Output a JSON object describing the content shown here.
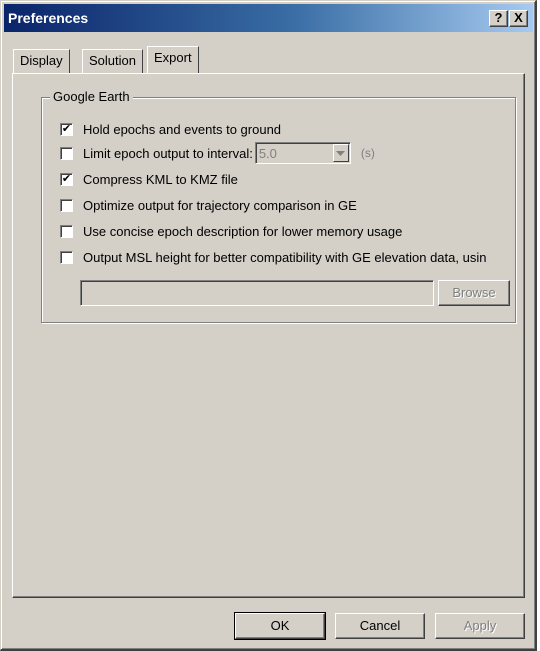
{
  "window": {
    "title": "Preferences"
  },
  "title_buttons": {
    "help": "?",
    "close": "X"
  },
  "tabs": [
    {
      "label": "Display",
      "active": false
    },
    {
      "label": "Solution",
      "active": false
    },
    {
      "label": "Export",
      "active": true
    }
  ],
  "export": {
    "group_title": "Google Earth",
    "options": [
      {
        "label": "Hold epochs and events to ground",
        "checked": true,
        "mark": "✔"
      },
      {
        "label": "Limit epoch output to interval:",
        "checked": false,
        "mark": ""
      },
      {
        "label": "Compress KML to KMZ file",
        "checked": true,
        "mark": "✔"
      },
      {
        "label": "Optimize output for trajectory comparison in GE",
        "checked": false,
        "mark": ""
      },
      {
        "label": "Use concise epoch description for lower memory usage",
        "checked": false,
        "mark": ""
      },
      {
        "label": "Output MSL height for better compatibility with GE elevation data, usin",
        "checked": false,
        "mark": ""
      }
    ],
    "interval": {
      "value": "5.0",
      "unit": "(s)",
      "enabled": false
    },
    "path_value": "",
    "browse_label": "Browse"
  },
  "footer": {
    "ok_label": "OK",
    "cancel_label": "Cancel",
    "apply_label": "Apply"
  },
  "colors": {
    "face": "#d4d0c8",
    "title_start": "#0a246a",
    "title_end": "#a6caf0"
  }
}
